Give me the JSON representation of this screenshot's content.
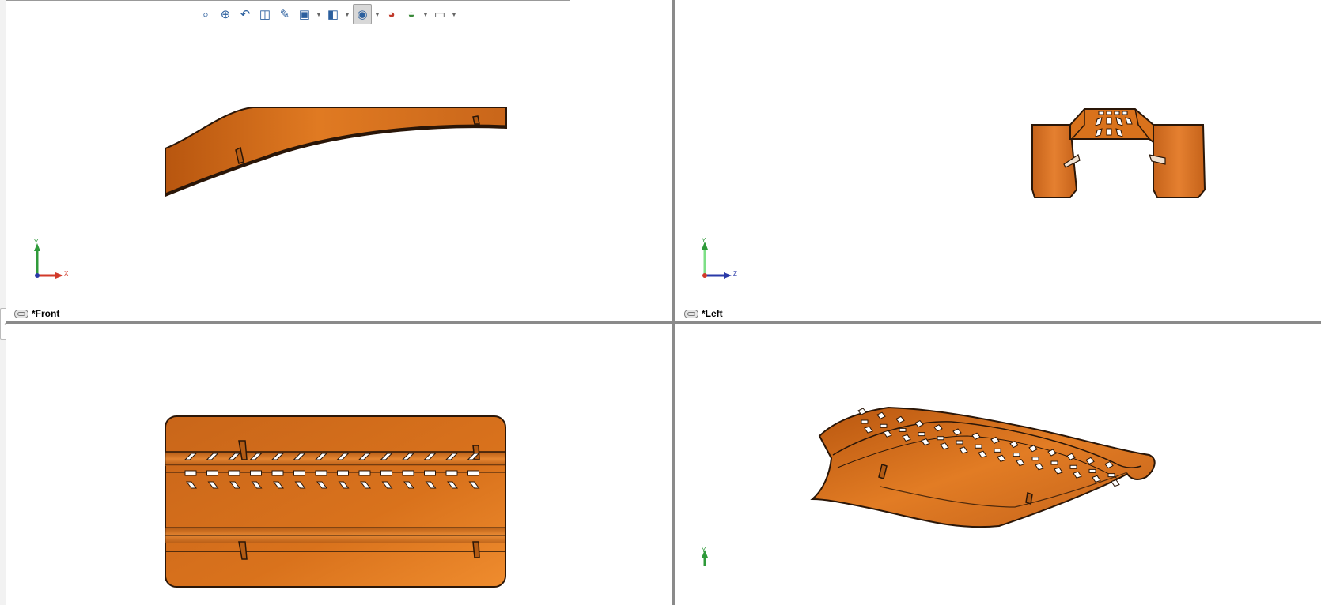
{
  "toolbar": {
    "icons": [
      "zoom-to-fit-icon",
      "zoom-to-area-icon",
      "previous-view-icon",
      "section-view-icon",
      "dynamic-annotation-icon",
      "view-orientation-icon",
      "display-style-icon",
      "hide-show-items-icon",
      "edit-appearance-icon",
      "apply-scene-icon",
      "view-settings-icon"
    ],
    "active_icon": "hide-show-items-icon"
  },
  "viewports": {
    "front": {
      "label": "*Front",
      "triad": {
        "vertical": "Y",
        "horizontal": "X"
      }
    },
    "left": {
      "label": "*Left",
      "triad": {
        "vertical": "Y",
        "horizontal": "Z"
      }
    },
    "top": {
      "label": ""
    },
    "iso": {
      "label": "",
      "triad": {
        "vertical": "Y"
      }
    }
  },
  "colors": {
    "part_fill": "#d9721c",
    "part_highlight": "#f2913a",
    "part_shadow": "#9c4a0c",
    "edge": "#2a1608",
    "divider": "#8a8a8a",
    "axis_x": "#d23a2a",
    "axis_y": "#2f9a3a",
    "axis_z": "#2a3aa8"
  }
}
